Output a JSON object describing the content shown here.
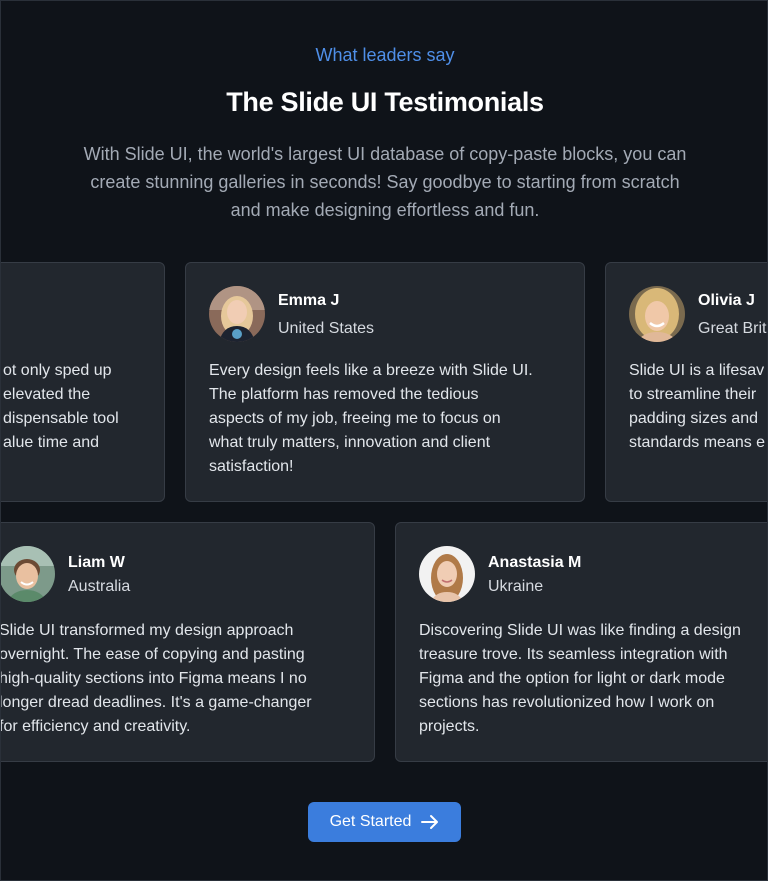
{
  "header": {
    "eyebrow": "What leaders say",
    "title": "The Slide UI Testimonials",
    "subtitle_lines": [
      "With Slide UI, the world's largest UI database of copy-paste blocks, you can",
      "create stunning galleries in seconds! Say goodbye to starting from scratch",
      "and make designing effortless and fun."
    ]
  },
  "row1": [
    {
      "name": "",
      "country": "",
      "quote_lines": [
        "ot only sped up",
        "elevated the",
        "dispensable tool",
        "alue time and"
      ]
    },
    {
      "name": "Emma J",
      "country": "United States",
      "quote_lines": [
        "Every design feels like a breeze with Slide UI.",
        "The platform has removed the tedious",
        "aspects of my job, freeing me to focus on",
        "what truly matters, innovation and client",
        "satisfaction!"
      ]
    },
    {
      "name": "Olivia J",
      "country": "Great Brit",
      "quote_lines": [
        "Slide UI is a lifesav",
        "to streamline their",
        "padding sizes and",
        "standards means e"
      ]
    }
  ],
  "row2": [
    {
      "name": "Liam W",
      "country": "Australia",
      "quote_lines": [
        "Slide UI transformed my design approach",
        "overnight. The ease of copying and pasting",
        "high-quality sections into Figma means I no",
        "longer dread deadlines. It's a game-changer",
        "for efficiency and creativity."
      ]
    },
    {
      "name": "Anastasia M",
      "country": "Ukraine",
      "quote_lines": [
        "Discovering Slide UI was like finding a design",
        "treasure trove. Its seamless integration with",
        "Figma and the option for light or dark mode",
        "sections has revolutionized how I work on",
        "projects."
      ]
    }
  ],
  "cta": {
    "label": "Get Started",
    "icon": "arrow-right-icon"
  },
  "colors": {
    "background": "#0f1319",
    "card": "#22272e",
    "accent": "#3b7ddd",
    "eyebrow": "#4f8fe8"
  }
}
